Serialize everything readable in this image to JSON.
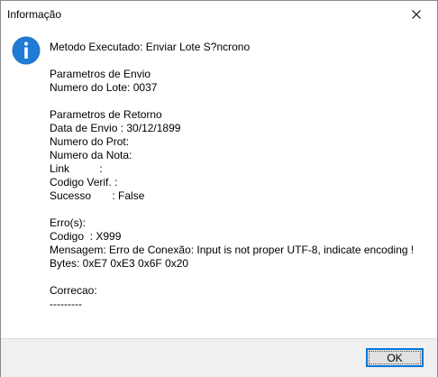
{
  "window": {
    "title": "Informação",
    "close_icon": "close-icon"
  },
  "dialog": {
    "icon": "info-icon",
    "icon_color": "#1e73c8",
    "lines": [
      "Metodo Executado: Enviar Lote S?ncrono",
      "",
      "Parametros de Envio",
      "Numero do Lote: 0037",
      "",
      "Parametros de Retorno",
      "Data de Envio : 30/12/1899",
      "Numero do Prot:",
      "Numero da Nota:",
      "Link          :",
      "Codigo Verif. :",
      "Sucesso       : False",
      "",
      "Erro(s):",
      "Codigo  : X999",
      "Mensagem: Erro de Conexão: Input is not proper UTF-8, indicate encoding !",
      "Bytes: 0xE7 0xE3 0x6F 0x20",
      "",
      "Correcao:",
      "---------"
    ]
  },
  "footer": {
    "ok_label": "OK",
    "accent": "#0078d7"
  }
}
